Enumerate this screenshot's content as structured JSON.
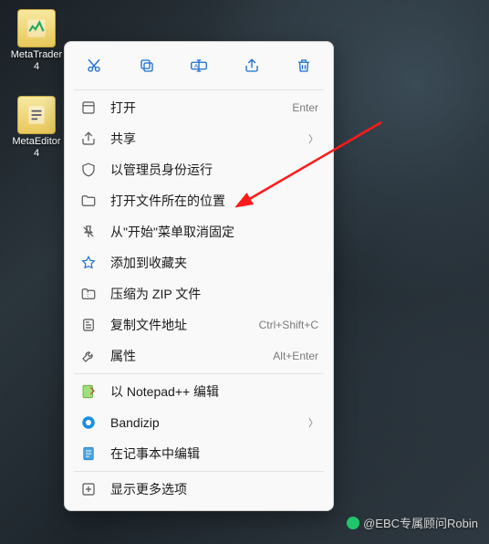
{
  "desktop": {
    "icons": [
      {
        "label": "MetaTrader 4"
      },
      {
        "label": "MetaEditor 4"
      }
    ]
  },
  "menu": {
    "toolbar": [
      "cut",
      "copy",
      "rename",
      "share",
      "delete"
    ],
    "items": [
      {
        "icon": "open",
        "label": "打开",
        "hint": "Enter"
      },
      {
        "icon": "share",
        "label": "共享",
        "chev": true
      },
      {
        "icon": "admin",
        "label": "以管理员身份运行"
      },
      {
        "icon": "folder",
        "label": "打开文件所在的位置"
      },
      {
        "icon": "unpin",
        "label": "从\"开始\"菜单取消固定"
      },
      {
        "icon": "star",
        "label": "添加到收藏夹"
      },
      {
        "icon": "zip",
        "label": "压缩为 ZIP 文件"
      },
      {
        "icon": "copypath",
        "label": "复制文件地址",
        "hint": "Ctrl+Shift+C"
      },
      {
        "icon": "wrench",
        "label": "属性",
        "hint": "Alt+Enter"
      }
    ],
    "group2": [
      {
        "icon": "notepadpp",
        "label": "以 Notepad++ 编辑"
      },
      {
        "icon": "bandizip",
        "label": "Bandizip",
        "chev": true
      },
      {
        "icon": "notepad",
        "label": "在记事本中编辑"
      }
    ],
    "more": {
      "label": "显示更多选项"
    }
  },
  "watermark": {
    "text": "@EBC专属顾问Robin"
  }
}
